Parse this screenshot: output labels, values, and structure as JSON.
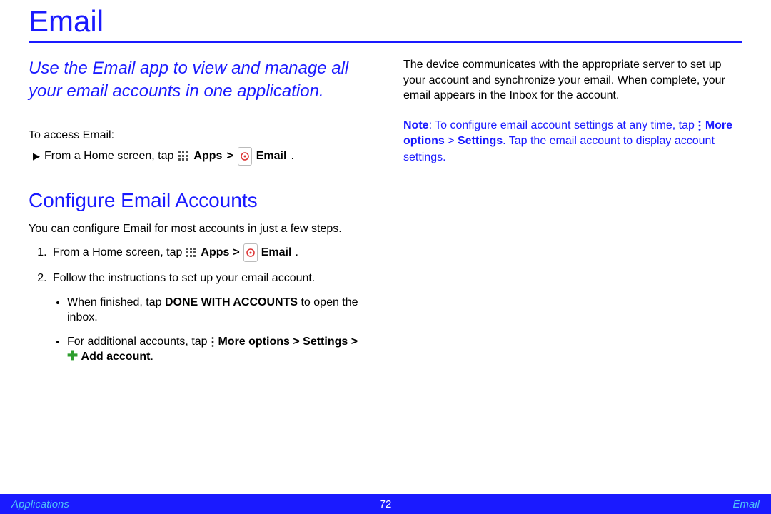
{
  "title": "Email",
  "intro": "Use the Email app to view and manage all your email accounts in one application.",
  "access_lead": "To access Email:",
  "access_line": {
    "prefix": "From a Home screen, tap",
    "apps": "Apps",
    "gt": ">",
    "email": "Email",
    "dot": "."
  },
  "section2_title": "Configure Email Accounts",
  "section2_para": "You can configure Email for most accounts in just a few steps.",
  "step1": {
    "prefix": "From a Home screen, tap",
    "apps": "Apps",
    "gt": ">",
    "email": "Email",
    "dot": "."
  },
  "step2": "Follow the instructions to set up your email account.",
  "sub_a": {
    "p1": "When finished, tap ",
    "b": "DONE WITH ACCOUNTS",
    "p2": " to open the inbox."
  },
  "sub_b": {
    "p1": "For additional accounts, tap ",
    "mo": "More options",
    "gt1": " > ",
    "set": "Settings",
    "gt2": " > ",
    "add": "Add account",
    "dot": "."
  },
  "col2_para": "The device communicates with the appropriate server to set up your account and synchronize your email. When complete, your email appears in the Inbox for the account.",
  "note": {
    "label": "Note",
    "p1": ": To configure email account settings at any time, tap ",
    "mo": "More options",
    "gt": " > ",
    "set": "Settings",
    "p2": ". Tap the email account to display account settings."
  },
  "footer": {
    "left": "Applications",
    "center": "72",
    "right": "Email"
  }
}
